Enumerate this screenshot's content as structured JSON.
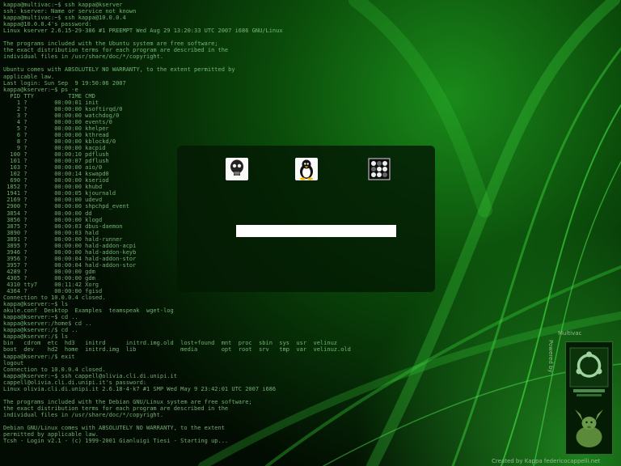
{
  "theme": {
    "accent": "#1fbf1f",
    "background": "#031503",
    "text": "#8fd88f",
    "panel": "#062a06"
  },
  "terminal": {
    "lines": [
      "kappa@multivac:~$ ssh kappa@kserver",
      "ssh: kserver: Name or service not known",
      "kappa@multivac:~$ ssh kappa@10.0.0.4",
      "kappa@10.0.0.4's password:",
      "Linux kserver 2.6.15-29-386 #1 PREEMPT Wed Aug 29 13:20:33 UTC 2007 i686 GNU/Linux",
      "",
      "The programs included with the Ubuntu system are free software;",
      "the exact distribution terms for each program are described in the",
      "individual files in /usr/share/doc/*/copyright.",
      "",
      "Ubuntu comes with ABSOLUTELY NO WARRANTY, to the extent permitted by",
      "applicable law.",
      "Last login: Sun Sep  9 19:50:06 2007",
      "kappa@kserver:~$ ps -e",
      "  PID TTY          TIME CMD",
      "    1 ?        00:00:01 init",
      "    2 ?        00:00:00 ksoftirqd/0",
      "    3 ?        00:00:00 watchdog/0",
      "    4 ?        00:00:00 events/0",
      "    5 ?        00:00:00 khelper",
      "    6 ?        00:00:00 kthread",
      "    8 ?        00:00:00 kblockd/0",
      "    9 ?        00:00:00 kacpid",
      "  100 ?        00:00:10 pdflush",
      "  101 ?        00:00:07 pdflush",
      "  103 ?        00:00:00 aio/0",
      "  102 ?        00:00:14 kswapd0",
      "  690 ?        00:00:00 kseriod",
      " 1852 ?        00:00:00 khubd",
      " 1941 ?        00:00:05 kjournald",
      " 2169 ?        00:00:00 udevd",
      " 2900 ?        00:00:00 shpchpd_event",
      " 3854 ?        00:00:00 dd",
      " 3856 ?        00:00:00 klogd",
      " 3875 ?        00:00:03 dbus-daemon",
      " 3890 ?        00:00:03 hald",
      " 3891 ?        00:00:00 hald-runner",
      " 3895 ?        00:00:00 hald-addon-acpi",
      " 3946 ?        00:00:00 hald-addon-keyb",
      " 3956 ?        00:00:04 hald-addon-stor",
      " 3957 ?        00:00:04 hald-addon-stor",
      " 4289 ?        00:00:00 gdm",
      " 4305 ?        00:00:00 gdm",
      " 4310 tty7     00:11:42 Xorg",
      " 4364 ?        00:00:00 fgisd",
      "Connection to 10.0.0.4 closed.",
      "kappa@kserver:~$ ls",
      "akule.conf  Desktop  Examples  teamspeak  wget-log",
      "kappa@kserver:~$ cd ..",
      "kappa@kserver:/home$ cd ..",
      "kappa@kserver:/$ cd ..",
      "kappa@kserver:/$ ls",
      "bin   cdrom  etc  hd3   initrd      initrd.img.old  lost+found  mnt  proc  sbin  sys  usr  velinuz",
      "boot  dev    hd2  home  initrd.img  lib             media       opt  root  srv   tmp  var  velinuz.old",
      "kappa@kserver:/$ exit",
      "logout",
      "Connection to 10.0.0.4 closed.",
      "kappa@kserver:~$ ssh cappell@olivia.cli.di.unipi.it",
      "cappell@olivia.cli.di.unipi.it's password:",
      "Linux olivia.cli.di.unipi.it 2.6.18-4-k7 #1 SMP Wed May 9 23:42:01 UTC 2007 i686",
      "",
      "The programs included with the Debian GNU/Linux system are free software;",
      "the exact distribution terms for each program are described in the",
      "individual files in /usr/share/doc/*/copyright.",
      "",
      "Debian GNU/Linux comes with ABSOLUTELY NO WARRANTY, to the extent",
      "permitted by applicable law.",
      "Tcsh - Login v2.1 - (c) 1999-2001 Gianluigi Tiesi - Starting up..."
    ]
  },
  "login": {
    "sessions": [
      {
        "icon": "skull-icon"
      },
      {
        "icon": "tux-icon"
      },
      {
        "icon": "grid-icon"
      }
    ],
    "username_value": ""
  },
  "branding": {
    "logo_text": "Multivac",
    "powered_by": "Powered by",
    "ubuntu_icon": "ubuntu-logo-icon",
    "mascot_icon": "elephant-mascot-icon",
    "credit": "Created by Kappa federicocappelli.net"
  }
}
